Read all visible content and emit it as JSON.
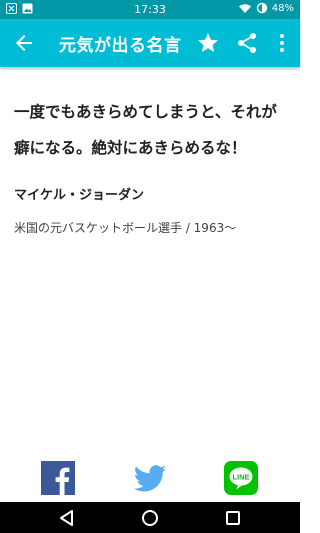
{
  "status": {
    "time": "17:33",
    "battery": "48%"
  },
  "app_bar": {
    "title": "元気が出る名言"
  },
  "quote": {
    "text": "一度でもあきらめてしまうと、それが癖になる。絶対にあきらめるな！"
  },
  "author": {
    "name": "マイケル・ジョーダン"
  },
  "description": {
    "text": "米国の元バスケットボール選手 / 1963〜"
  },
  "share": {
    "facebook_color": "#3b5998",
    "twitter_color": "#55acee",
    "line_color": "#00c300"
  },
  "icons": [
    "back-arrow-icon",
    "star-icon",
    "share-icon",
    "more-vert-icon",
    "facebook-icon",
    "twitter-icon",
    "line-icon"
  ]
}
